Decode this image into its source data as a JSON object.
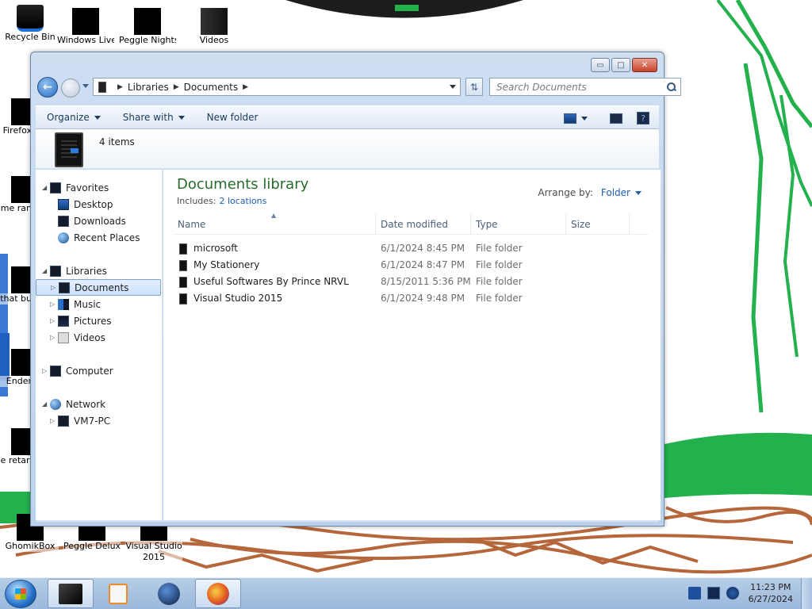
{
  "desktop": {
    "icons": [
      {
        "label": "Recycle Bin"
      },
      {
        "label": "Windows Live"
      },
      {
        "label": "Peggle Nights"
      },
      {
        "label": "Videos"
      },
      {
        "label": "Firefox"
      },
      {
        "label": "some ran"
      },
      {
        "label": "that bu"
      },
      {
        "label": "Ender"
      },
      {
        "label": "none retards"
      },
      {
        "label": "GhomikBox"
      },
      {
        "label": "Peggle Deluxe"
      },
      {
        "label": "Visual Studio 2015"
      }
    ]
  },
  "window": {
    "caption": {
      "minimize": "▭",
      "maximize": "□",
      "close": "✕"
    },
    "breadcrumb": [
      "Libraries",
      "Documents"
    ],
    "search": {
      "placeholder": "Search Documents"
    },
    "toolbar": {
      "organize": "Organize",
      "share_with": "Share with",
      "new_folder": "New folder"
    },
    "info": {
      "items_count": "4 items"
    },
    "nav": {
      "favorites": "Favorites",
      "desktop": "Desktop",
      "downloads": "Downloads",
      "recent_places": "Recent Places",
      "libraries": "Libraries",
      "documents": "Documents",
      "music": "Music",
      "pictures": "Pictures",
      "videos": "Videos",
      "computer": "Computer",
      "network": "Network",
      "vm7pc": "VM7-PC"
    },
    "library": {
      "title": "Documents library",
      "includes_label": "Includes:",
      "includes_link": "2 locations",
      "arrange_label": "Arrange by:",
      "arrange_value": "Folder"
    },
    "columns": {
      "name": "Name",
      "date": "Date modified",
      "type": "Type",
      "size": "Size"
    },
    "rows": [
      {
        "name": "microsoft",
        "date": "6/1/2024 8:45 PM",
        "type": "File folder",
        "size": ""
      },
      {
        "name": "My Stationery",
        "date": "6/1/2024 8:47 PM",
        "type": "File folder",
        "size": ""
      },
      {
        "name": "Useful Softwares By Prince NRVL",
        "date": "8/15/2011 5:36 PM",
        "type": "File folder",
        "size": ""
      },
      {
        "name": "Visual Studio 2015",
        "date": "6/1/2024 9:48 PM",
        "type": "File folder",
        "size": ""
      }
    ]
  },
  "taskbar": {
    "clock_time": "11:23 PM",
    "clock_date": "6/27/2024"
  },
  "colors": {
    "library_title": "#256c2a",
    "link": "#1c5fb5",
    "wallpaper_green": "#22b14c",
    "wallpaper_brown": "#b5663a"
  }
}
